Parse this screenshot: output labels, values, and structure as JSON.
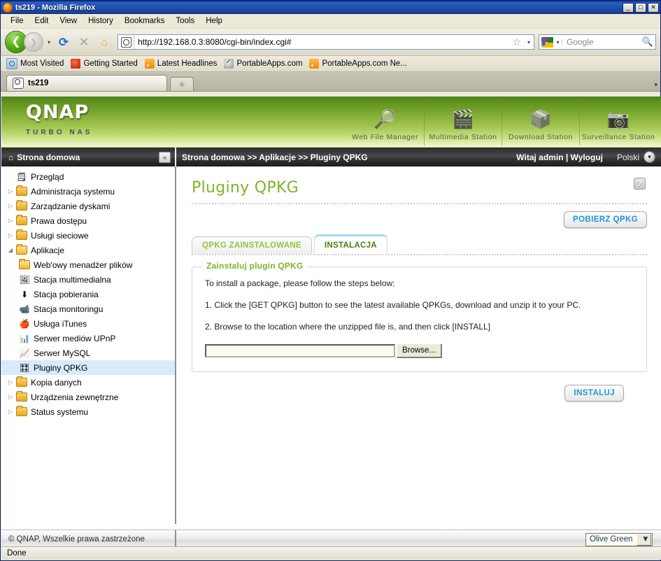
{
  "window": {
    "title": "ts219 - Mozilla Firefox",
    "icon": "firefox-icon",
    "minimize": "_",
    "maximize": "□",
    "close": "✕"
  },
  "menubar": [
    {
      "label": "File"
    },
    {
      "label": "Edit"
    },
    {
      "label": "View"
    },
    {
      "label": "History"
    },
    {
      "label": "Bookmarks"
    },
    {
      "label": "Tools"
    },
    {
      "label": "Help"
    }
  ],
  "toolbar": {
    "back_icon": "❮",
    "forward_icon": "❯",
    "dropdown_icon": "▾",
    "reload_icon": "⟳",
    "stop_icon": "✕",
    "home_icon": "⌂",
    "url": "http://192.168.0.3:8080/cgi-bin/index.cgi#",
    "star_icon": "☆",
    "url_dropdown_icon": "▾",
    "search_engine": "google-icon",
    "search_placeholder": "Google",
    "search_icon": "🔍"
  },
  "bookmarks": [
    {
      "label": "Most Visited",
      "icon": "most-visited-icon"
    },
    {
      "label": "Getting Started",
      "icon": "firefox-icon"
    },
    {
      "label": "Latest Headlines",
      "icon": "rss-icon"
    },
    {
      "label": "PortableApps.com",
      "icon": "portableapps-icon"
    },
    {
      "label": "PortableApps.com Ne...",
      "icon": "rss-icon"
    }
  ],
  "browser_tabs": {
    "active": "ts219",
    "new_tab_icon": "✳",
    "list_icon": "▾"
  },
  "qnap": {
    "brand": "QNAP",
    "tagline": "TURBO NAS",
    "stations": [
      {
        "label": "Web File Manager",
        "icon": "folder-search-icon"
      },
      {
        "label": "Multimedia Station",
        "icon": "media-clapper-icon"
      },
      {
        "label": "Download Station",
        "icon": "download-box-icon"
      },
      {
        "label": "Surveillance Station",
        "icon": "dome-camera-icon"
      }
    ],
    "home_label": "Strona domowa",
    "home_icon": "home-icon",
    "collapse_icon": "«",
    "breadcrumb": "Strona domowa >> Aplikacje >> Pluginy QPKG",
    "greeting": "Witaj admin | Wyloguj",
    "language": "Polski",
    "language_dropdown_icon": "▼"
  },
  "sidebar": {
    "items": [
      {
        "label": "Przegląd",
        "level": 1,
        "icon": "overview-icon",
        "arrow": "",
        "selected": false
      },
      {
        "label": "Administracja systemu",
        "level": 1,
        "icon": "folder-icon",
        "arrow": "▷",
        "selected": false
      },
      {
        "label": "Zarządzanie dyskami",
        "level": 1,
        "icon": "folder-icon",
        "arrow": "▷",
        "selected": false
      },
      {
        "label": "Prawa dostępu",
        "level": 1,
        "icon": "folder-icon",
        "arrow": "▷",
        "selected": false
      },
      {
        "label": "Usługi sieciowe",
        "level": 1,
        "icon": "folder-icon",
        "arrow": "▷",
        "selected": false
      },
      {
        "label": "Aplikacje",
        "level": 1,
        "icon": "folder-open-icon",
        "arrow": "◢",
        "selected": false
      },
      {
        "label": "Web'owy menadżer plików",
        "level": 2,
        "icon": "folder-open-icon",
        "arrow": "",
        "selected": false
      },
      {
        "label": "Stacja multimedialna",
        "level": 2,
        "icon": "photo-icon",
        "arrow": "",
        "selected": false
      },
      {
        "label": "Stacja pobierania",
        "level": 2,
        "icon": "download-icon",
        "arrow": "",
        "selected": false
      },
      {
        "label": "Stacja monitoringu",
        "level": 2,
        "icon": "camera-icon",
        "arrow": "",
        "selected": false
      },
      {
        "label": "Usługa iTunes",
        "level": 2,
        "icon": "apple-icon",
        "arrow": "",
        "selected": false
      },
      {
        "label": "Serwer mediów UPnP",
        "level": 2,
        "icon": "upnp-icon",
        "arrow": "",
        "selected": false
      },
      {
        "label": "Serwer MySQL",
        "level": 2,
        "icon": "mysql-icon",
        "arrow": "",
        "selected": false
      },
      {
        "label": "Pluginy QPKG",
        "level": 2,
        "icon": "qpkg-icon",
        "arrow": "",
        "selected": true
      },
      {
        "label": "Kopia danych",
        "level": 1,
        "icon": "folder-icon",
        "arrow": "▷",
        "selected": false
      },
      {
        "label": "Urządzenia zewnętrzne",
        "level": 1,
        "icon": "folder-icon",
        "arrow": "▷",
        "selected": false
      },
      {
        "label": "Status systemu",
        "level": 1,
        "icon": "folder-icon",
        "arrow": "▷",
        "selected": false
      }
    ]
  },
  "main": {
    "page_title": "Pluginy QPKG",
    "help_icon": "?",
    "get_qpkg_button": "POBIERZ QPKG",
    "tabs": [
      {
        "label": "QPKG ZAINSTALOWANE",
        "active": false
      },
      {
        "label": "INSTALACJA",
        "active": true
      }
    ],
    "panel": {
      "legend": "Zainstaluj plugin QPKG",
      "lines": [
        "To install a package, please follow the steps below:",
        "1. Click the [GET QPKG] button to see the latest available QPKGs, download and unzip it to your PC.",
        "2. Browse to the location where the unzipped file is, and then click [INSTALL]"
      ],
      "file_value": "",
      "browse_button": "Browse..."
    },
    "install_button": "INSTALUJ"
  },
  "footer": {
    "copyright": "© QNAP, Wszelkie prawa zastrzeżone",
    "theme": "Olive Green",
    "theme_arrow_icon": "▼"
  },
  "statusbar": {
    "text": "Done"
  },
  "colors": {
    "accent_green": "#7fb32c",
    "tab_blue": "#2196d6",
    "titlebar_blue": "#0a246a",
    "selection_blue": "#d9ebfa"
  }
}
